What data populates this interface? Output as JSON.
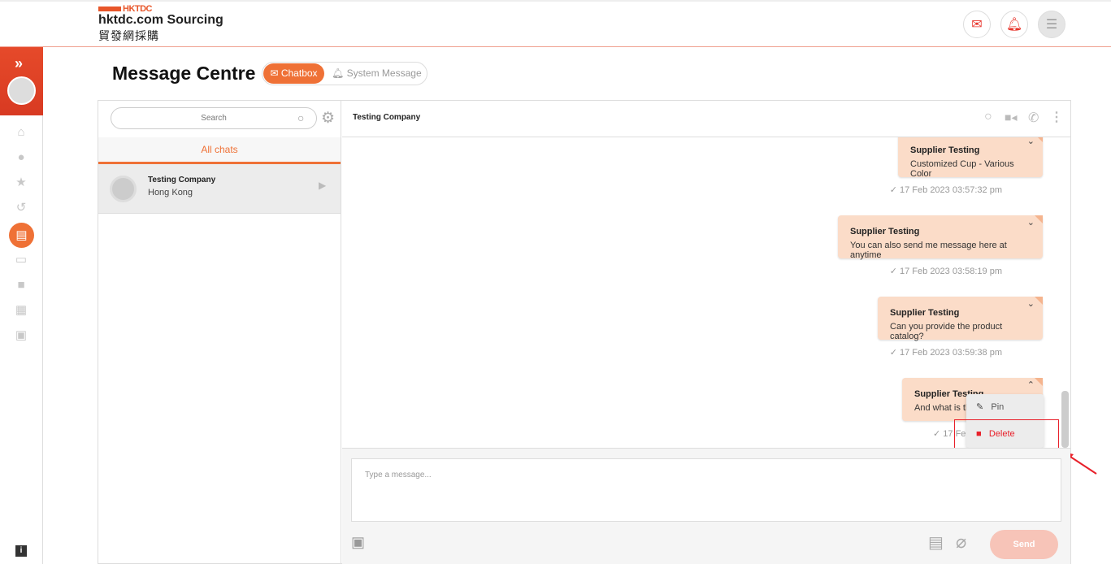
{
  "header": {
    "logo_mark": "HKTDC",
    "logo_title": "hktdc.com Sourcing",
    "logo_cn": "貿發網採購",
    "icons": [
      "mail-icon",
      "bell-icon",
      "menu-icon"
    ]
  },
  "page": {
    "title": "Message Centre",
    "tabs": [
      {
        "label": "Chatbox",
        "active": true
      },
      {
        "label": "System Message",
        "active": false
      }
    ]
  },
  "left": {
    "search_placeholder": "Search",
    "filter": "All chats",
    "chats": [
      {
        "name": "Testing Company",
        "location": "Hong Kong"
      }
    ]
  },
  "chat": {
    "title": "Testing Company",
    "messages": [
      {
        "sender": "Supplier Testing",
        "text": "Customized Cup - Various Color",
        "time": "17 Feb 2023 03:57:32 pm"
      },
      {
        "sender": "Supplier Testing",
        "text": "You can also send me message here at anytime",
        "time": "17 Feb 2023 03:58:19 pm"
      },
      {
        "sender": "Supplier Testing",
        "text": "Can you provide the product catalog?",
        "time": "17 Feb 2023 03:59:38 pm"
      },
      {
        "sender": "Supplier Testing",
        "text": "And what is th",
        "time": "17 Fe"
      }
    ],
    "menu": {
      "pin": "Pin",
      "delete": "Delete"
    },
    "input_placeholder": "Type a message...",
    "send": "Send"
  },
  "colors": {
    "accent": "#ef7136",
    "bubble": "#fbdcc8",
    "delete": "#e8202a"
  }
}
